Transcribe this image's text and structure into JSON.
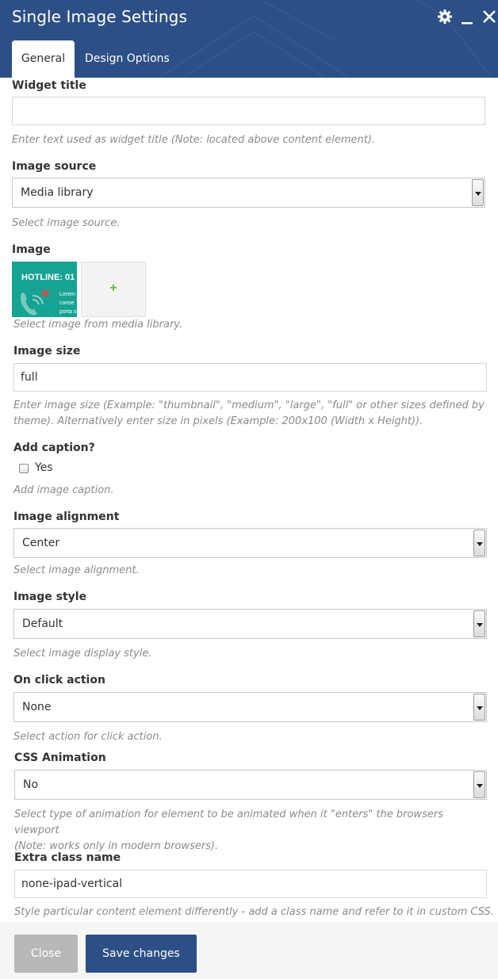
{
  "dialog": {
    "title": "Single Image Settings",
    "tabs": [
      {
        "label": "General"
      },
      {
        "label": "Design Options"
      }
    ]
  },
  "fields": {
    "widget_title": {
      "label": "Widget title",
      "value": "",
      "help": "Enter text used as widget title (Note: located above content element)."
    },
    "image_source": {
      "label": "Image source",
      "value": "Media library",
      "help": "Select image source."
    },
    "image": {
      "label": "Image",
      "thumb_text": "HOTLINE: 01",
      "thumb_lorem": "Lorem conse porta s",
      "add_symbol": "+",
      "help": "Select image from media library."
    },
    "image_size": {
      "label": "Image size",
      "value": "full",
      "help_line1": "Enter image size (Example: \"thumbnail\", \"medium\", \"large\", \"full\" or other sizes defined by",
      "help_line2": "theme). Alternatively enter size in pixels (Example: 200x100 (Width x Height))."
    },
    "add_caption": {
      "label": "Add caption?",
      "option": "Yes",
      "checked": false,
      "help": "Add image caption."
    },
    "image_alignment": {
      "label": "Image alignment",
      "value": "Center",
      "help": "Select image alignment."
    },
    "image_style": {
      "label": "Image style",
      "value": "Default",
      "help": "Select image display style."
    },
    "on_click": {
      "label": "On click action",
      "value": "None",
      "help": "Select action for click action."
    },
    "css_animation": {
      "label": "CSS Animation",
      "value": "No",
      "help_line1": "Select type of animation for element to be animated when it \"enters\" the browsers viewport",
      "help_line2": "(Note: works only in modern browsers)."
    },
    "extra_class": {
      "label": "Extra class name",
      "value": "none-ipad-vertical",
      "help": "Style particular content element differently - add a class name and refer to it in custom CSS."
    }
  },
  "footer": {
    "close_label": "Close",
    "save_label": "Save changes"
  },
  "colors": {
    "header": "#2c4f85",
    "save_button": "#2c4f85",
    "close_button": "#b8b8b8",
    "thumb": "#17a392"
  }
}
